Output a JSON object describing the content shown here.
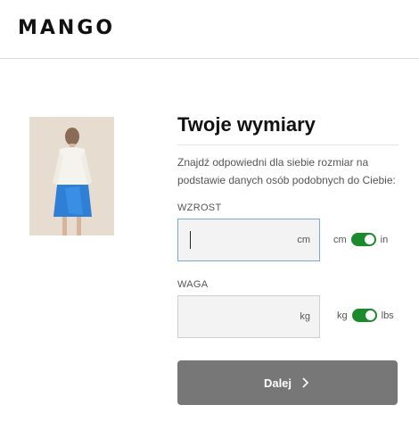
{
  "header": {
    "logo": "MANGO"
  },
  "main": {
    "title": "Twoje wymiary",
    "description": "Znajdź odpowiedni dla siebie rozmiar na podstawie danych osób podobnych do Ciebie:",
    "height": {
      "label": "WZROST",
      "value": "",
      "unit": "cm",
      "toggle_left": "cm",
      "toggle_right": "in"
    },
    "weight": {
      "label": "WAGA",
      "value": "",
      "unit": "kg",
      "toggle_left": "kg",
      "toggle_right": "lbs"
    },
    "next_button": "Dalej"
  },
  "colors": {
    "toggle_on": "#1a8a2d",
    "button_bg": "#777777",
    "focus_border": "#7aa7d6"
  }
}
